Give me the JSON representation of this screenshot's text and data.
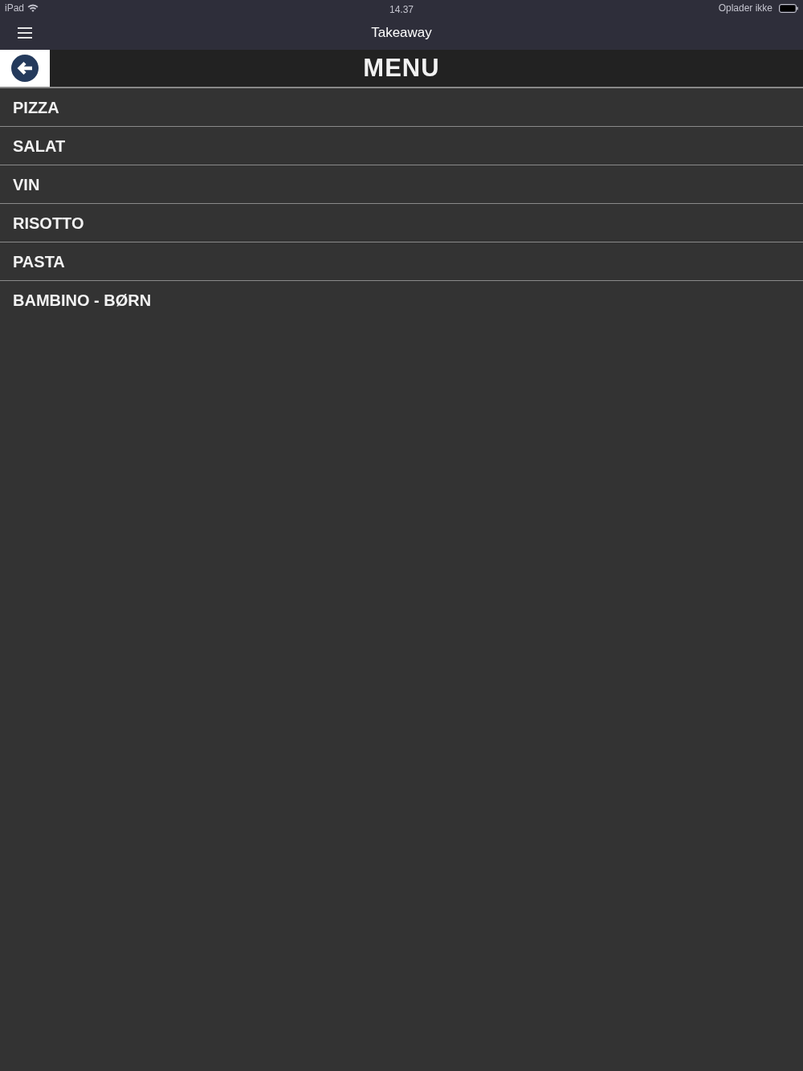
{
  "status_bar": {
    "device": "iPad",
    "time": "14.37",
    "charging": "Oplader ikke"
  },
  "nav_bar": {
    "title": "Takeaway"
  },
  "header": {
    "title": "MENU"
  },
  "menu": {
    "items": [
      {
        "label": "PIZZA"
      },
      {
        "label": "SALAT"
      },
      {
        "label": "VIN"
      },
      {
        "label": "RISOTTO"
      },
      {
        "label": "PASTA"
      },
      {
        "label": "BAMBINO - BØRN"
      }
    ]
  }
}
